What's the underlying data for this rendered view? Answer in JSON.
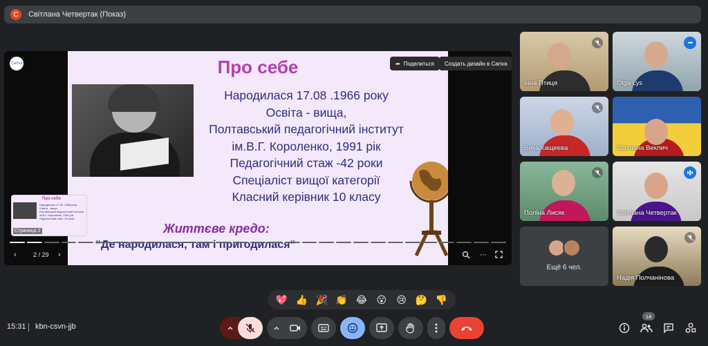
{
  "header": {
    "presenter_initial": "С",
    "presenter_label": "Світлана Четвертак (Показ)"
  },
  "presentation": {
    "canva_logo": "Canva",
    "share_label": "Поделиться",
    "create_label": "Создать дизайн в Canva",
    "thumbnail_label": "Страница 2",
    "page_indicator": "2 / 29",
    "progress_current": 2,
    "progress_total": 29,
    "slide": {
      "title": "Про себе",
      "lines": [
        "Народилася 17.08 .1966 року",
        "Освіта  - вища,",
        "Полтавський педагогічний інститут",
        "ім.В.Г. Короленко, 1991 рік",
        "Педагогічний стаж -42 роки",
        "Спеціаліст вищої категорії",
        "Класний керівник 10 класу"
      ],
      "motto_title": "Життєве кредо:",
      "motto": "“Де народилася, там і пригодилася“"
    }
  },
  "participants": [
    {
      "name": "Інна Птиця",
      "status": "muted"
    },
    {
      "name": "Olga Lys",
      "status": "more"
    },
    {
      "name": "Вика Кащеева",
      "status": "muted"
    },
    {
      "name": "Світлана Веклич",
      "status": "none"
    },
    {
      "name": "Поліна Лисяк",
      "status": "muted"
    },
    {
      "name": "Світлана Четвертак",
      "status": "speaking"
    },
    {
      "name": "Надія Полчанінова",
      "status": "muted"
    }
  ],
  "more_participants": {
    "label": "Ещё 6 чел."
  },
  "reactions": [
    "💖",
    "👍",
    "🎉",
    "👏",
    "😂",
    "😮",
    "😢",
    "🤔",
    "👎"
  ],
  "footer": {
    "time": "15:31",
    "meeting_code": "kbn-csvn-jjb",
    "participant_count": "14"
  },
  "colors": {
    "background": "#202124",
    "tile": "#3c4043",
    "accent_blue": "#1a73e8",
    "end_call": "#ea4335",
    "mic_off": "#f9dedc"
  }
}
